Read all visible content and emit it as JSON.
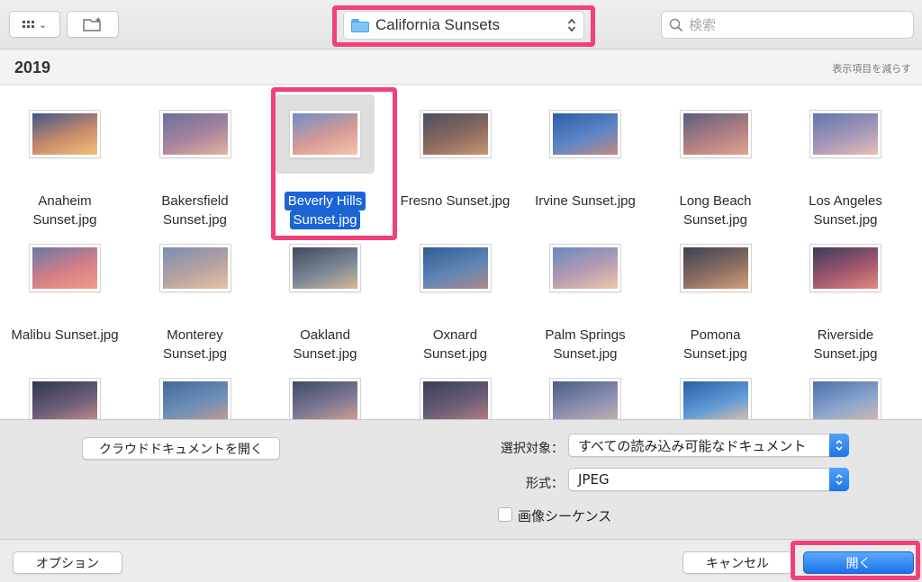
{
  "toolbar": {
    "location": "California Sunsets",
    "search_placeholder": "検索"
  },
  "section": {
    "title": "2019",
    "show_less": "表示項目を減らす"
  },
  "files": [
    {
      "line1": "Anaheim",
      "line2": "Sunset.jpg",
      "selected": false
    },
    {
      "line1": "Bakersfield",
      "line2": "Sunset.jpg",
      "selected": false
    },
    {
      "line1": "Beverly Hills",
      "line2": "Sunset.jpg",
      "selected": true
    },
    {
      "line1": "Fresno Sunset.jpg",
      "line2": "",
      "selected": false
    },
    {
      "line1": "Irvine Sunset.jpg",
      "line2": "",
      "selected": false
    },
    {
      "line1": "Long Beach",
      "line2": "Sunset.jpg",
      "selected": false
    },
    {
      "line1": "Los Angeles",
      "line2": "Sunset.jpg",
      "selected": false
    },
    {
      "line1": "Malibu Sunset.jpg",
      "line2": "",
      "selected": false
    },
    {
      "line1": "Monterey",
      "line2": "Sunset.jpg",
      "selected": false
    },
    {
      "line1": "Oakland",
      "line2": "Sunset.jpg",
      "selected": false
    },
    {
      "line1": "Oxnard",
      "line2": "Sunset.jpg",
      "selected": false
    },
    {
      "line1": "Palm Springs",
      "line2": "Sunset.jpg",
      "selected": false
    },
    {
      "line1": "Pomona",
      "line2": "Sunset.jpg",
      "selected": false
    },
    {
      "line1": "Riverside",
      "line2": "Sunset.jpg",
      "selected": false
    },
    {
      "line1": "",
      "line2": "",
      "selected": false
    },
    {
      "line1": "",
      "line2": "",
      "selected": false
    },
    {
      "line1": "",
      "line2": "",
      "selected": false
    },
    {
      "line1": "",
      "line2": "",
      "selected": false
    },
    {
      "line1": "",
      "line2": "",
      "selected": false
    },
    {
      "line1": "",
      "line2": "",
      "selected": false
    },
    {
      "line1": "",
      "line2": "",
      "selected": false
    }
  ],
  "options": {
    "cloud_button": "クラウドドキュメントを開く",
    "enable_label": "選択対象：",
    "enable_value": "すべての読み込み可能なドキュメント",
    "format_label": "形式：",
    "format_value": "JPEG",
    "image_sequence": "画像シーケンス"
  },
  "bottom": {
    "options_button": "オプション",
    "cancel_button": "キャンセル",
    "open_button": "開く"
  },
  "colors": {
    "highlight": "#f2407a",
    "selection": "#1b64d6",
    "primary_button": "#1c73e8"
  }
}
